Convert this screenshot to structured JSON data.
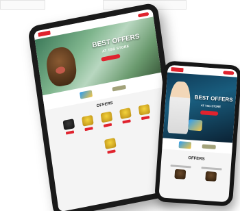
{
  "tablet": {
    "hero": {
      "title": "BEST OFFERS",
      "subtitle": "AT TSG STORE"
    },
    "offers_heading": "OFFERS",
    "chests": [
      {
        "kind": "dark"
      },
      {
        "kind": "gold"
      },
      {
        "kind": "gold"
      },
      {
        "kind": "gold"
      },
      {
        "kind": "gold"
      },
      {
        "kind": "gold"
      }
    ]
  },
  "phone": {
    "hero": {
      "title": "BEST OFFERS",
      "subtitle": "AT TSG STORE"
    },
    "offers_heading": "OFFERS"
  },
  "colors": {
    "brand_red": "#e0232e",
    "device_black": "#1a1a1a"
  }
}
